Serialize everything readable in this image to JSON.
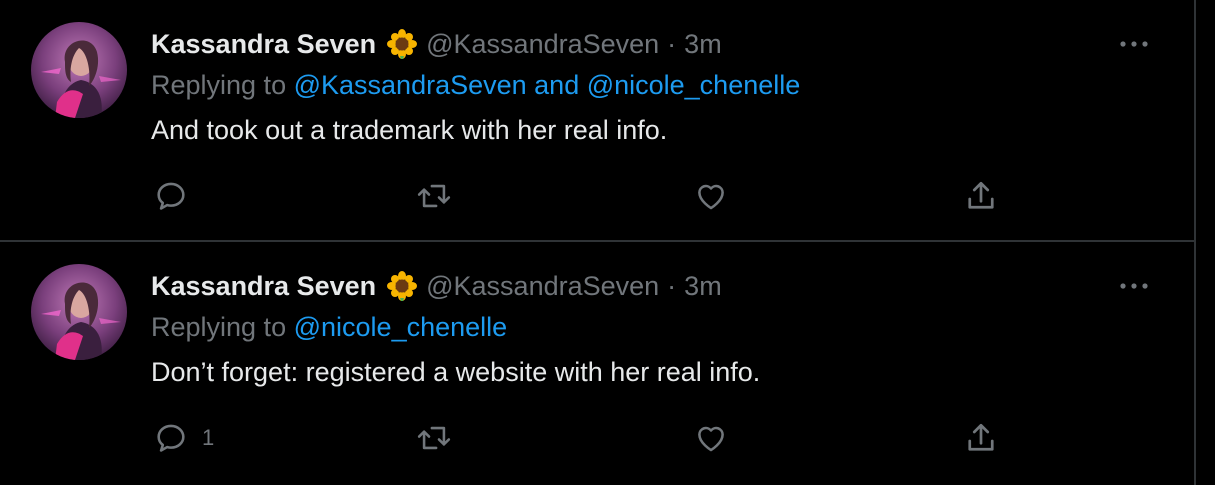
{
  "tweets": [
    {
      "author_name": "Kassandra Seven",
      "author_emoji": "sunflower-icon",
      "handle": "@KassandraSeven",
      "separator": "·",
      "time": "3m",
      "replying_prefix": "Replying to",
      "replying_to": "@KassandraSeven and @nicole_chenelle",
      "text": "And took out a trademark with her real info.",
      "reply_count": ""
    },
    {
      "author_name": "Kassandra Seven",
      "author_emoji": "sunflower-icon",
      "handle": "@KassandraSeven",
      "separator": "·",
      "time": "3m",
      "replying_prefix": "Replying to",
      "replying_to": "@nicole_chenelle",
      "text": "Don’t forget: registered a website with her real info.",
      "reply_count": "1"
    }
  ],
  "colors": {
    "background": "#000000",
    "text_primary": "#e7e9ea",
    "text_secondary": "#71767b",
    "accent": "#1d9bf0",
    "divider": "#2f3336"
  },
  "icons": [
    "more-icon",
    "reply-icon",
    "retweet-icon",
    "like-icon",
    "share-icon"
  ]
}
